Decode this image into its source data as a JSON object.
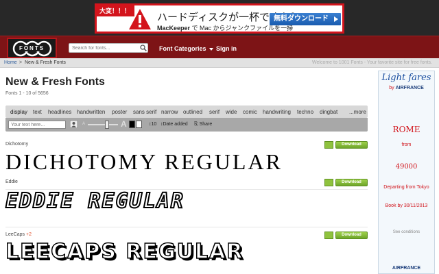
{
  "ad_top": {
    "tag": "大変！！！",
    "headline": "ハードディスクが一杯ですか？",
    "subline_brand": "MacKeeper",
    "subline_rest": " で Mac からジャンクファイルを一掃",
    "button_label": "無料ダウンロード"
  },
  "nav": {
    "logo_text": "FONTS",
    "search_placeholder": "Search for fonts...",
    "font_categories": "Font Categories",
    "sign_in": "Sign in"
  },
  "breadcrumb": {
    "home": "Home",
    "separator": ">",
    "current": "New & Fresh Fonts",
    "welcome": "Welcome to 1001 Fonts - Your favorite site for free fonts."
  },
  "main": {
    "title": "New & Fresh Fonts",
    "count": "Fonts 1 - 10 of 5656"
  },
  "filter_tabs": [
    {
      "label": "display"
    },
    {
      "label": "text"
    },
    {
      "label": "headlines"
    },
    {
      "label": "handwritten"
    },
    {
      "label": "poster"
    },
    {
      "label": "sans serif"
    },
    {
      "label": "narrow"
    },
    {
      "label": "outlined"
    },
    {
      "label": "serif"
    },
    {
      "label": "wide"
    },
    {
      "label": "comic"
    },
    {
      "label": "handwriting"
    },
    {
      "label": "techno"
    },
    {
      "label": "dingbat"
    },
    {
      "label": "...more"
    }
  ],
  "toolbar": {
    "text_placeholder": "Your text here...",
    "small_a": "A",
    "big_a": "A",
    "count_option": "10",
    "sort_label": "Date added",
    "share_label": "Share"
  },
  "fonts": [
    {
      "name": "Dichotomy",
      "extra": "",
      "preview": "DICHOTOMY  REGULAR",
      "download": "Download"
    },
    {
      "name": "Eddie",
      "extra": "",
      "preview": "EDDIE REGULAR",
      "download": "Download"
    },
    {
      "name": "LeeCaps",
      "extra": "+2",
      "preview": "LEECAPS REGULAR",
      "download": "Download"
    }
  ],
  "side_ad": {
    "title": "Light fares",
    "by": "by",
    "brand_inline": "AIRFRANCE",
    "destination": "ROME",
    "from": "from",
    "price": "49000",
    "departure": "Departing from Tokyo",
    "book_by": "Book by 30/11/2013",
    "conditions": "See conditions",
    "brand_footer": "AIRFRANCE"
  },
  "colors": {
    "nav_red": "#7d1416",
    "ad_red": "#d3141c",
    "download_green": "#8fc23e",
    "airfrance_blue": "#1a3c7a"
  }
}
